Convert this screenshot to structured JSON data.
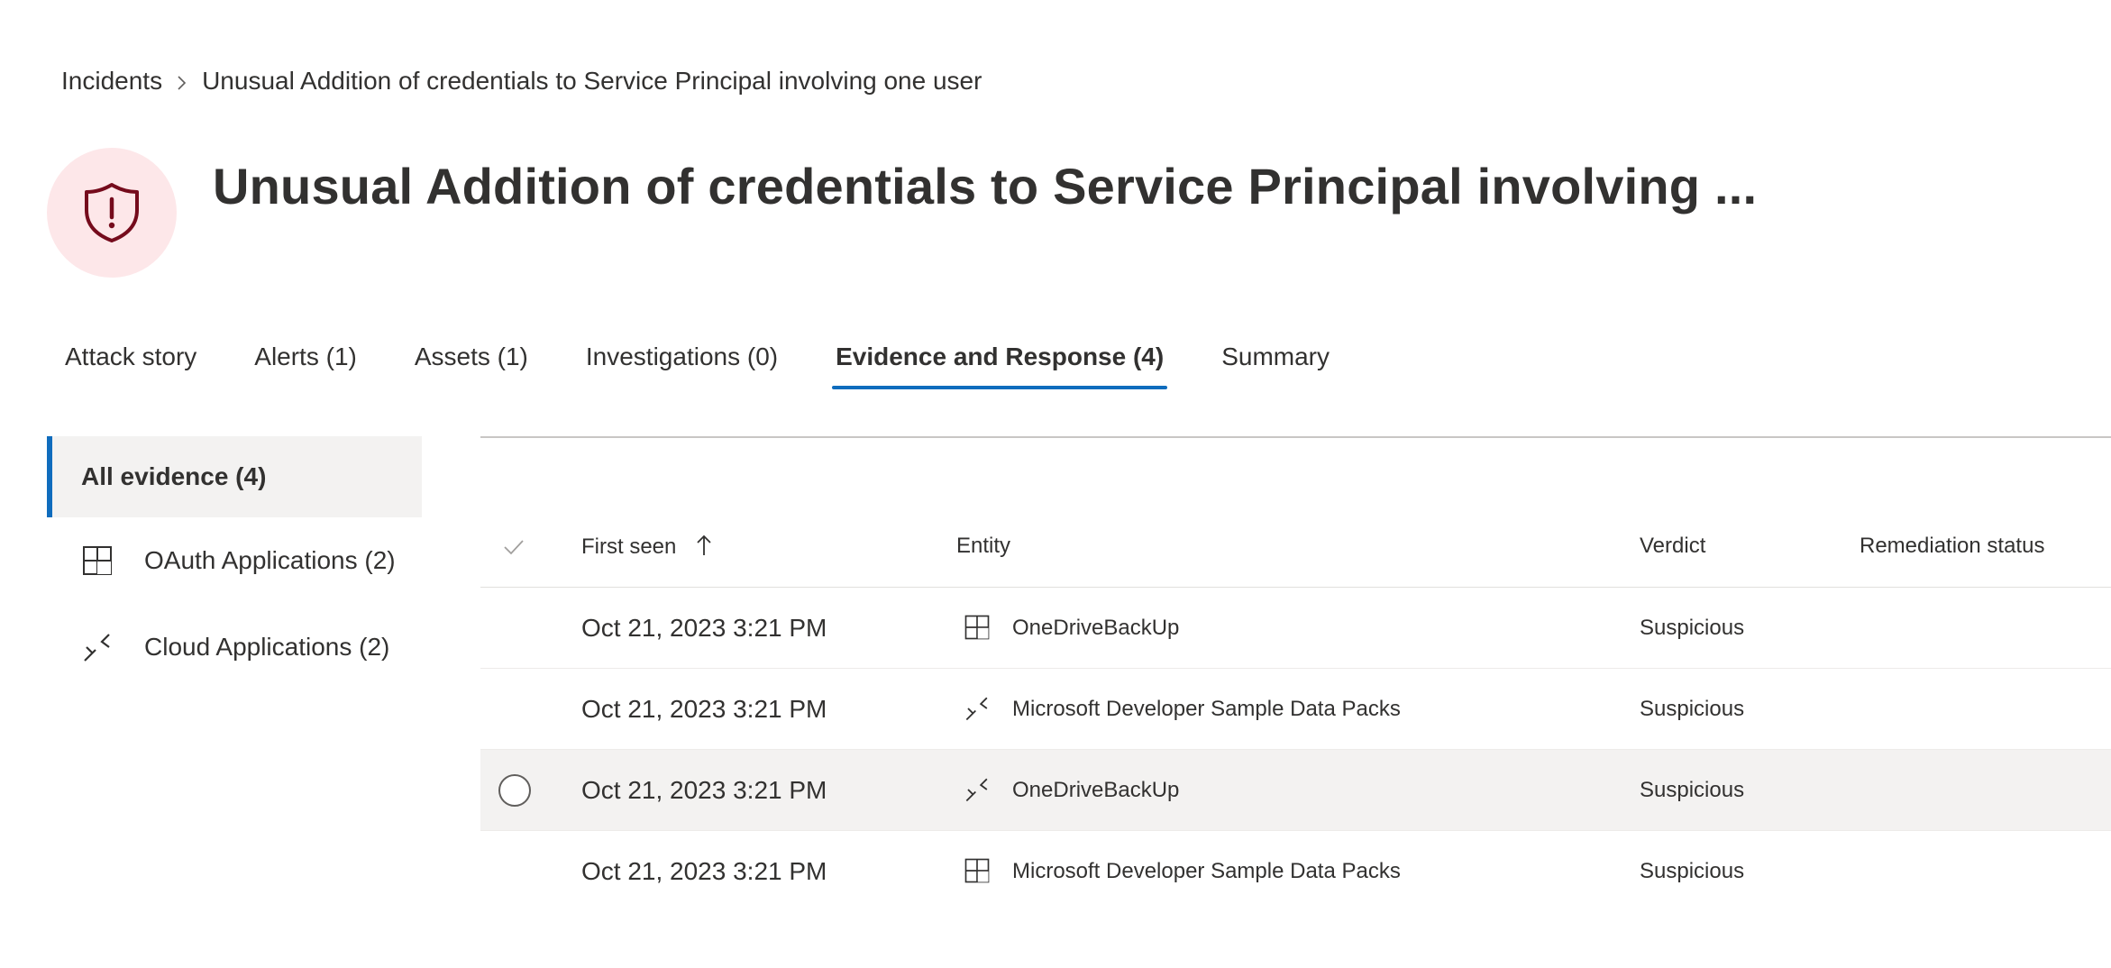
{
  "breadcrumb": {
    "root": "Incidents",
    "current": "Unusual Addition of credentials to Service Principal involving one user"
  },
  "header": {
    "title": "Unusual Addition of credentials to Service Principal involving ...",
    "icon": "shield-alert-icon",
    "icon_color": "#750b1c",
    "icon_bg": "#fde7e9"
  },
  "tabs": [
    {
      "label": "Attack story",
      "active": false
    },
    {
      "label": "Alerts (1)",
      "active": false
    },
    {
      "label": "Assets (1)",
      "active": false
    },
    {
      "label": "Investigations (0)",
      "active": false
    },
    {
      "label": "Evidence and Response (4)",
      "active": true
    },
    {
      "label": "Summary",
      "active": false
    }
  ],
  "sidebar": {
    "items": [
      {
        "label": "All evidence (4)",
        "active": true
      },
      {
        "label": "OAuth Applications (2)",
        "icon": "oauth-app-icon",
        "active": false
      },
      {
        "label": "Cloud Applications (2)",
        "icon": "cloud-app-icon",
        "active": false
      }
    ]
  },
  "grid": {
    "columns": {
      "first_seen": "First seen",
      "entity": "Entity",
      "verdict": "Verdict",
      "remediation": "Remediation status"
    },
    "sort_indicator": "arrow-up-icon",
    "rows": [
      {
        "first_seen": "Oct 21, 2023 3:21 PM",
        "entity": "OneDriveBackUp",
        "entity_icon": "oauth-app-icon",
        "verdict": "Suspicious",
        "remediation": ""
      },
      {
        "first_seen": "Oct 21, 2023 3:21 PM",
        "entity": "Microsoft Developer Sample Data Packs",
        "entity_icon": "cloud-app-icon",
        "verdict": "Suspicious",
        "remediation": ""
      },
      {
        "first_seen": "Oct 21, 2023 3:21 PM",
        "entity": "OneDriveBackUp",
        "entity_icon": "cloud-app-icon",
        "verdict": "Suspicious",
        "remediation": ""
      },
      {
        "first_seen": "Oct 21, 2023 3:21 PM",
        "entity": "Microsoft Developer Sample Data Packs",
        "entity_icon": "oauth-app-icon",
        "verdict": "Suspicious",
        "remediation": ""
      }
    ]
  },
  "colors": {
    "accent": "#0f6cbd",
    "selected_bg": "#f3f2f1"
  }
}
